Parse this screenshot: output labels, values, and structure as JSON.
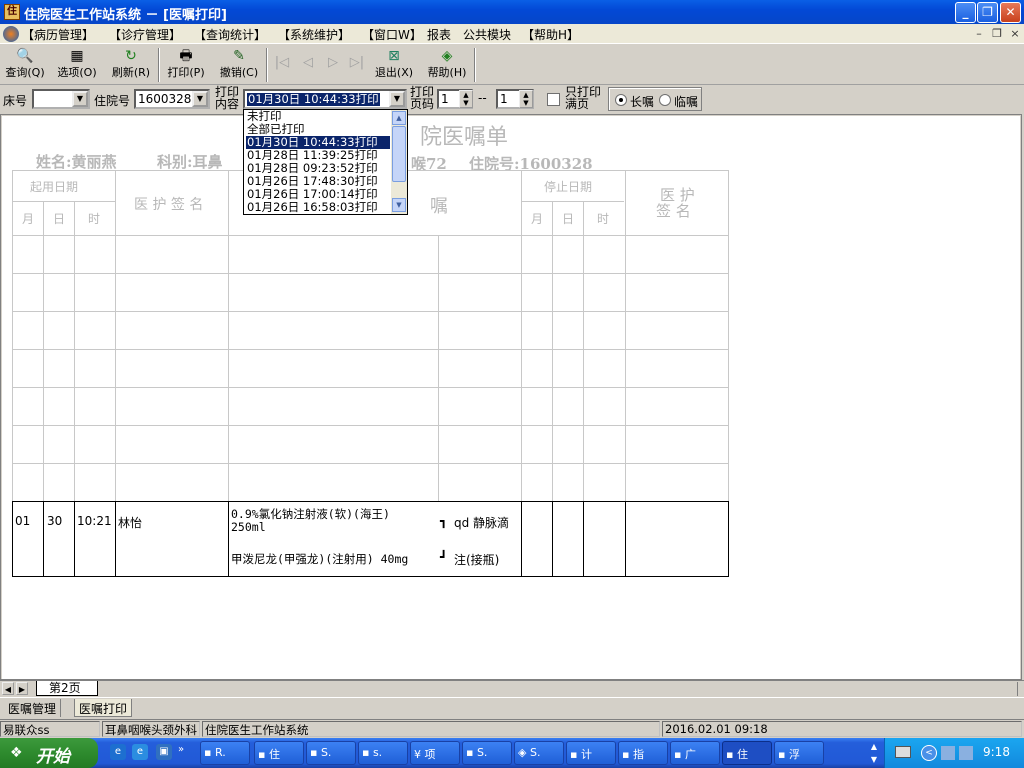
{
  "window": {
    "title": "住院医生工作站系统 － [医嘱打印]",
    "minimize": "_",
    "maximize": "❐",
    "close": "✕"
  },
  "menu": {
    "items": [
      "【病历管理】",
      "【诊疗管理】",
      "【查询统计】",
      "【系统维护】",
      "【窗口W】",
      "报表",
      "公共模块",
      "【帮助H】"
    ],
    "mdi_min": "–",
    "mdi_restore": "❐",
    "mdi_close": "×"
  },
  "toolbar": {
    "query": "查询(Q)",
    "options": "选项(O)",
    "refresh": "刷新(R)",
    "print": "打印(P)",
    "undo": "撤销(C)",
    "exit": "退出(X)",
    "help": "帮助(H)"
  },
  "filter": {
    "bed_label": "床号",
    "bed_value": "",
    "admission_label": "住院号",
    "admission_value": "1600328",
    "print_content_label_1": "打印",
    "print_content_label_2": "内容",
    "print_content_value": "01月30日  10:44:33打印",
    "page_label_1": "打印",
    "page_label_2": "页码",
    "page_from": "1",
    "page_sep": "--",
    "page_to": "1",
    "only_full_1": "只打印",
    "only_full_2": "满页",
    "long_term": "长嘱",
    "temporary": "临嘱",
    "selected_order_type": "长嘱"
  },
  "dropdown": {
    "options": [
      "未打印",
      "全部已打印",
      "01月30日  10:44:33打印",
      "01月28日  11:39:25打印",
      "01月28日  09:23:52打印",
      "01月26日  17:48:30打印",
      "01月26日  17:00:14打印",
      "01月26日  16:58:03打印"
    ],
    "selected_index": 2
  },
  "document": {
    "title_partial": "院医嘱单",
    "patient_name": "姓名:黄丽燕",
    "dept_partial": "科别:耳鼻",
    "room_partial": "喉72",
    "admission_no": "住院号:1600328",
    "col_start_date": "起用日期",
    "col_month": "月",
    "col_day": "日",
    "col_time": "时",
    "col_signature": "医 护 签 名",
    "col_order": "嘱",
    "col_stop_date": "停止日期",
    "col_stop_month": "月",
    "col_stop_day": "日",
    "col_stop_time": "时",
    "col_stop_sign_1": "医 护",
    "col_stop_sign_2": "签 名"
  },
  "order_row": {
    "month": "01",
    "day": "30",
    "time": "10:21",
    "doctor": "林怡",
    "drug1_line1": "0.9%氯化钠注射液(软)(海王)",
    "drug1_line2": "250ml",
    "drug2": "甲泼尼龙(甲强龙)(注射用)  40mg",
    "bracket_top": "┓",
    "bracket_bottom": "┛",
    "freq": "qd 静脉滴",
    "route_cont": "注(接瓶)"
  },
  "page_tabs": {
    "nav_prev": "◀",
    "nav_next": "▶",
    "current": "第2页"
  },
  "bottom_tabs": [
    "医嘱管理",
    "医嘱打印"
  ],
  "status": {
    "user": "易联众ss",
    "dept": "耳鼻咽喉头颈外科",
    "system": "住院医生工作站系统",
    "datetime": "2016.02.01 09:18"
  },
  "taskbar": {
    "start": "开始",
    "tasks": [
      "R.",
      "住",
      "S.",
      "s.",
      "项",
      "S.",
      "S.",
      "计",
      "指",
      "广",
      "住",
      "浮"
    ],
    "clock": "9:18"
  },
  "colors": {
    "title_blue": "#0a5fe6",
    "selection": "#0a246a",
    "taskbar": "#245edb",
    "start_green": "#2e8b2e"
  }
}
